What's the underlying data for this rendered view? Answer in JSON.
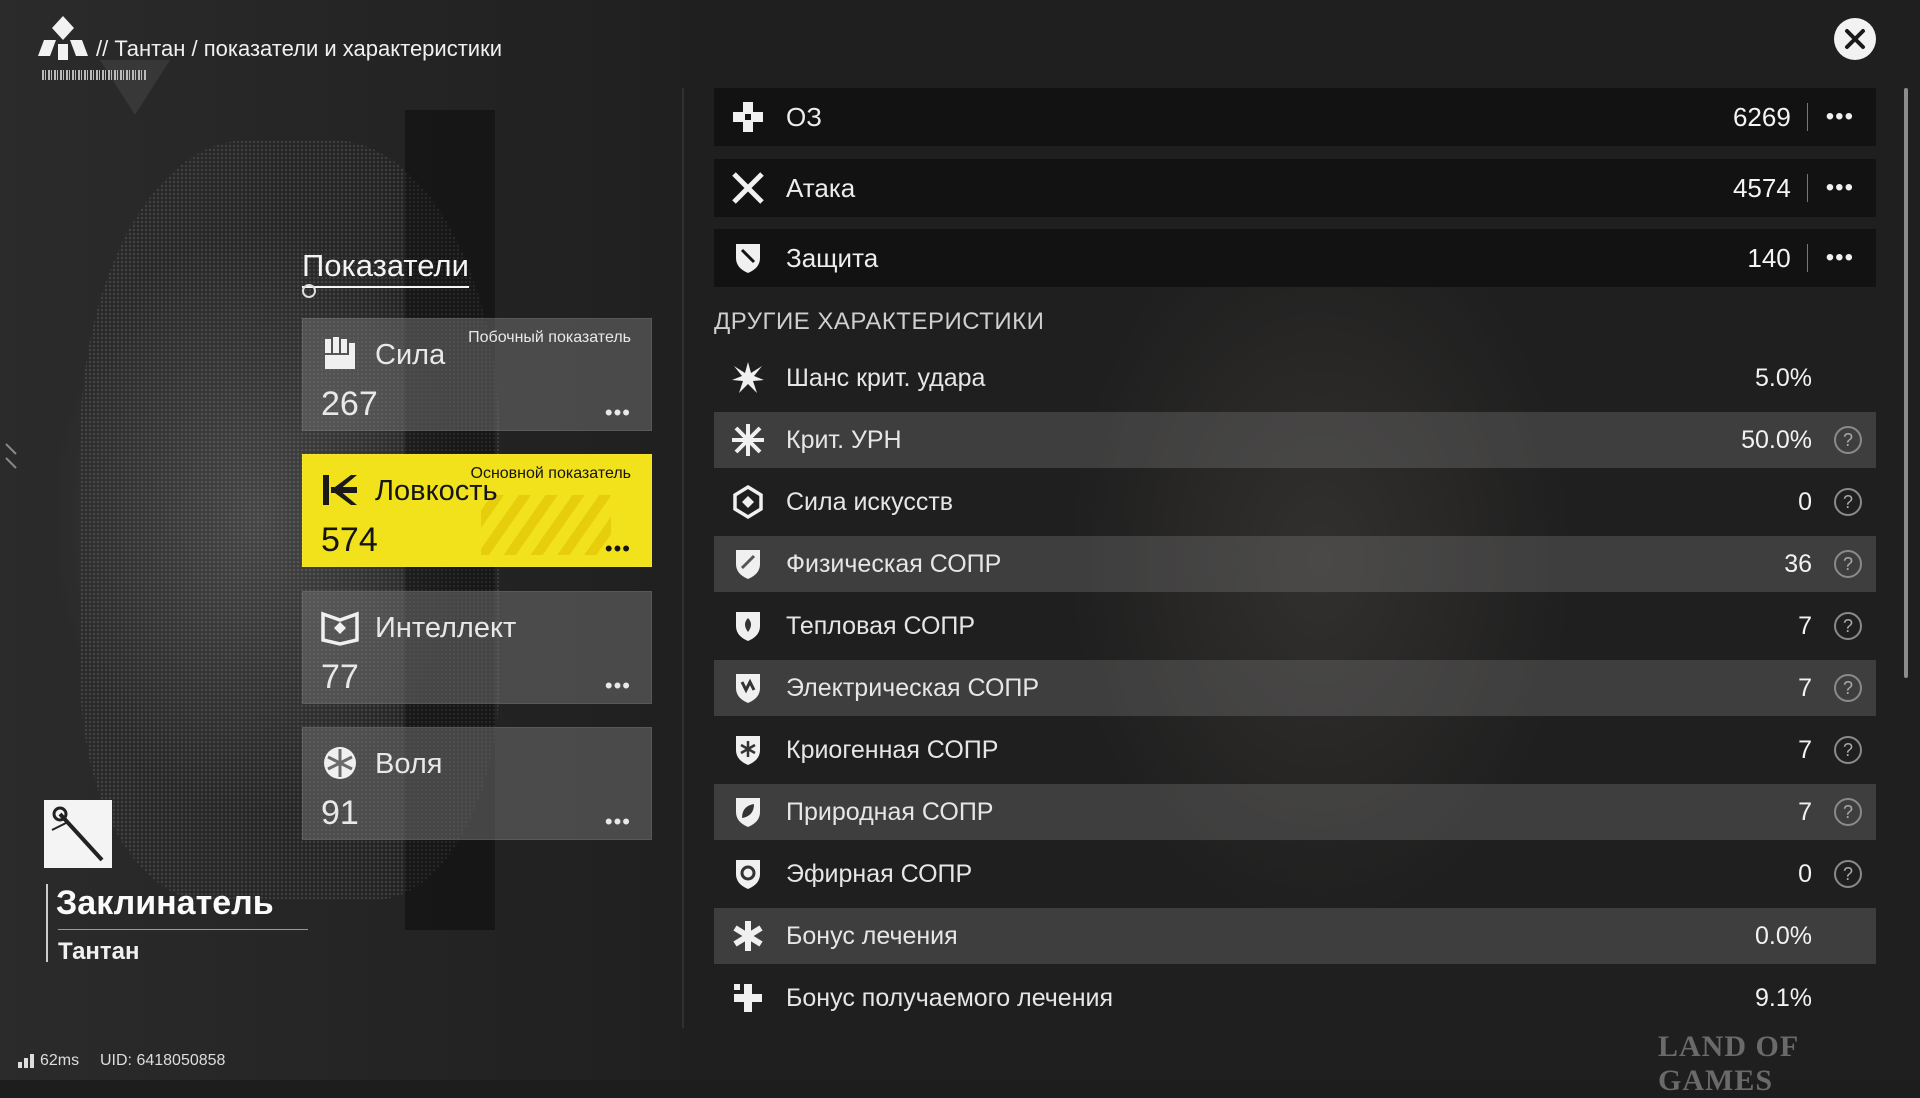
{
  "header": {
    "breadcrumb": "// Тантан / показатели и характеристики"
  },
  "stats_panel": {
    "title": "Показатели",
    "more_glyph": "•••",
    "cards": [
      {
        "name": "Сила",
        "value": "267",
        "tag": "Побочный показатель",
        "icon": "fist-icon",
        "active": false
      },
      {
        "name": "Ловкость",
        "value": "574",
        "tag": "Основной показатель",
        "icon": "agility-icon",
        "active": true
      },
      {
        "name": "Интеллект",
        "value": "77",
        "tag": "",
        "icon": "intellect-icon",
        "active": false
      },
      {
        "name": "Воля",
        "value": "91",
        "tag": "",
        "icon": "will-icon",
        "active": false
      }
    ]
  },
  "character": {
    "class_name": "Заклинатель",
    "name": "Тантан"
  },
  "main_stats": [
    {
      "label": "ОЗ",
      "value": "6269",
      "icon": "hp-cross-icon"
    },
    {
      "label": "Атака",
      "value": "4574",
      "icon": "attack-swords-icon"
    },
    {
      "label": "Защита",
      "value": "140",
      "icon": "defense-shield-icon"
    }
  ],
  "other_stats": {
    "title": "ДРУГИЕ ХАРАКТЕРИСТИКИ",
    "help_glyph": "?",
    "rows": [
      {
        "label": "Шанс крит. удара",
        "value": "5.0%",
        "help": false,
        "icon": "crit-burst-icon"
      },
      {
        "label": "Крит. УРН",
        "value": "50.0%",
        "help": true,
        "icon": "crit-damage-icon"
      },
      {
        "label": "Сила искусств",
        "value": "0",
        "help": true,
        "icon": "arts-power-icon"
      },
      {
        "label": "Физическая СОПР",
        "value": "36",
        "help": true,
        "icon": "physical-res-icon"
      },
      {
        "label": "Тепловая СОПР",
        "value": "7",
        "help": true,
        "icon": "heat-res-icon"
      },
      {
        "label": "Электрическая СОПР",
        "value": "7",
        "help": true,
        "icon": "electric-res-icon"
      },
      {
        "label": "Криогенная СОПР",
        "value": "7",
        "help": true,
        "icon": "cryo-res-icon"
      },
      {
        "label": "Природная СОПР",
        "value": "7",
        "help": true,
        "icon": "nature-res-icon"
      },
      {
        "label": "Эфирная СОПР",
        "value": "0",
        "help": true,
        "icon": "ether-res-icon"
      },
      {
        "label": "Бонус лечения",
        "value": "0.0%",
        "help": false,
        "icon": "heal-bonus-icon"
      },
      {
        "label": "Бонус получаемого лечения",
        "value": "9.1%",
        "help": false,
        "icon": "received-heal-icon"
      }
    ]
  },
  "footer": {
    "ping": "62ms",
    "uid": "UID: 6418050858",
    "watermark": "LAND OF GAMES"
  }
}
